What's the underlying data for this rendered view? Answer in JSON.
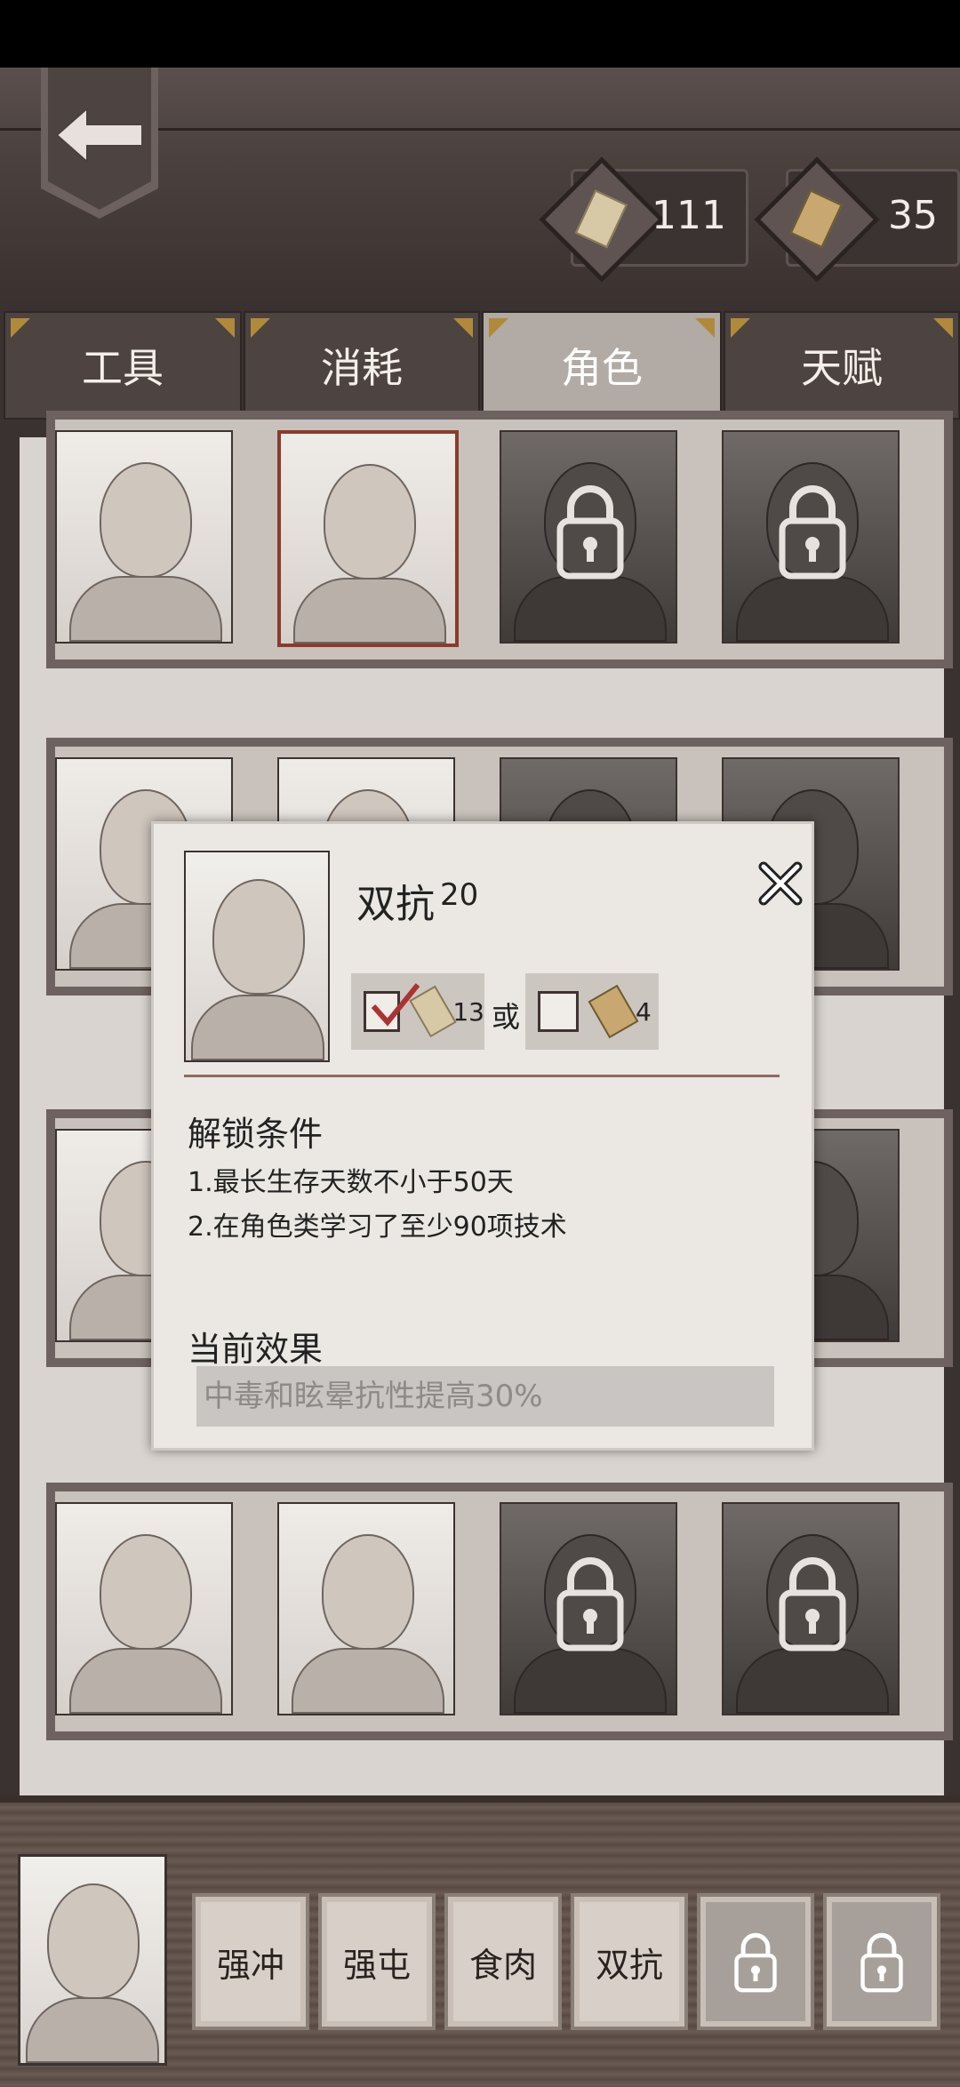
{
  "currencies": [
    {
      "value": "111",
      "icon": "scroll-ticket-icon"
    },
    {
      "value": "35",
      "icon": "gold-ticket-icon"
    }
  ],
  "tabs": [
    {
      "label": "工具"
    },
    {
      "label": "消耗"
    },
    {
      "label": "角色",
      "active": true
    },
    {
      "label": "天赋"
    }
  ],
  "dialog": {
    "name": "双抗",
    "level": "20",
    "option1_count": "13",
    "or": "或",
    "option2_count": "4",
    "unlock_title": "解锁条件",
    "conditions": [
      "1.最长生存天数不小于50天",
      "2.在角色类学习了至少90项技术"
    ],
    "effect_title": "当前效果",
    "effect": "中毒和眩晕抗性提高30%"
  },
  "skills": [
    {
      "label": "强冲"
    },
    {
      "label": "强屯"
    },
    {
      "label": "食肉"
    },
    {
      "label": "双抗"
    },
    {
      "label": "",
      "locked": true
    },
    {
      "label": "",
      "locked": true
    }
  ]
}
